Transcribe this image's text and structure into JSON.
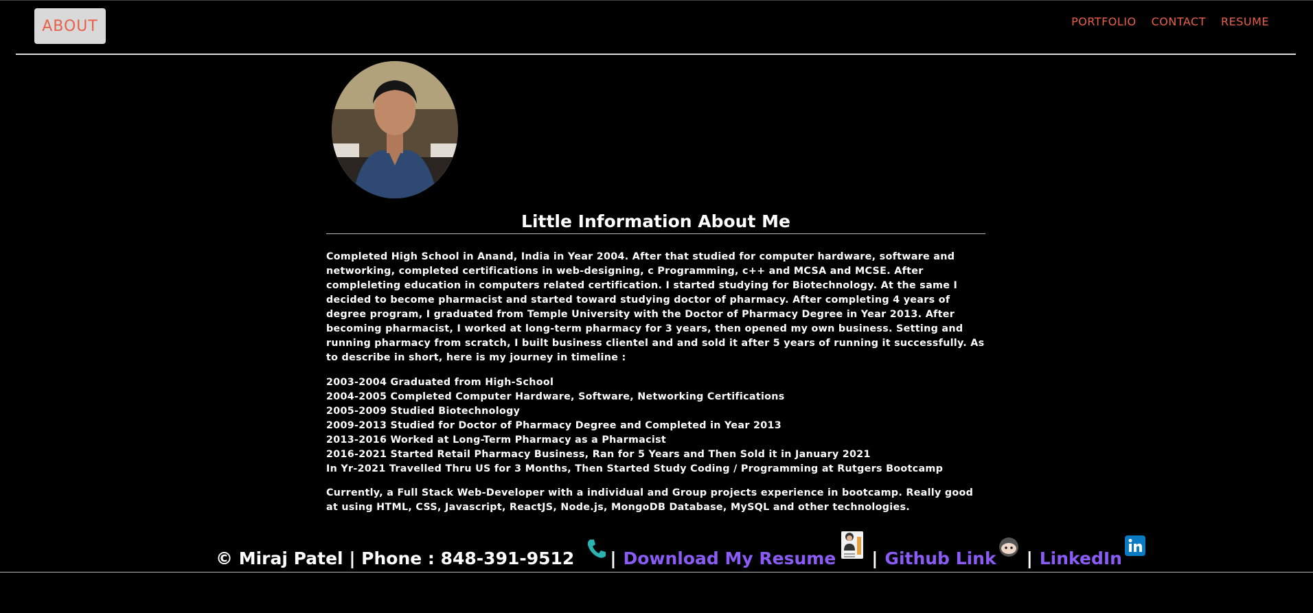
{
  "header": {
    "about_label": "ABOUT",
    "nav": [
      "PORTFOLIO",
      "CONTACT",
      "RESUME"
    ]
  },
  "main": {
    "title": "Little Information About Me",
    "intro": "Completed High School in Anand, India in Year 2004. After that studied for computer hardware, software and networking, completed certifications in web-designing, c Programming, c++ and MCSA and MCSE. After compleleting education in computers related certification. I started studying for Biotechnology. At the same I decided to become pharmacist and started toward studying doctor of pharmacy. After completing 4 years of degree program, I graduated from Temple University with the Doctor of Pharmacy Degree in Year 2013. After becoming pharmacist, I worked at long-term pharmacy for 3 years, then opened my own business. Setting and running pharmacy from scratch, I built business clientel and and sold it after 5 years of running it successfully. As to describe in short, here is my journey in timeline :",
    "timeline": [
      "2003-2004 Graduated from High-School",
      "2004-2005 Completed Computer Hardware, Software, Networking Certifications",
      "2005-2009 Studied Biotechnology",
      "2009-2013 Studied for Doctor of Pharmacy Degree and Completed in Year 2013",
      "2013-2016 Worked at Long-Term Pharmacy as a Pharmacist",
      "2016-2021 Started Retail Pharmacy Business, Ran for 5 Years and Then Sold it in January 2021",
      "In Yr-2021 Travelled Thru US for 3 Months, Then Started Study Coding / Programming at Rutgers Bootcamp"
    ],
    "current": "Currently, a Full Stack Web-Developer with a individual and Group projects experience in bootcamp. Really good at using HTML, CSS, Javascript, ReactJS, Node.js, MongoDB Database, MySQL and other technologies."
  },
  "footer": {
    "copyright": "© Miraj Patel | Phone : 848-391-9512",
    "sep": "|",
    "resume_link": "Download My Resume",
    "github_link": "Github Link",
    "linkedin_link": "LinkedIn",
    "icons": [
      "phone-icon",
      "resume-icon",
      "github-icon",
      "linkedin-icon"
    ]
  },
  "colors": {
    "background": "#000000",
    "accent": "#e8604a",
    "link": "#8a5cf5",
    "text": "#ffffff"
  }
}
